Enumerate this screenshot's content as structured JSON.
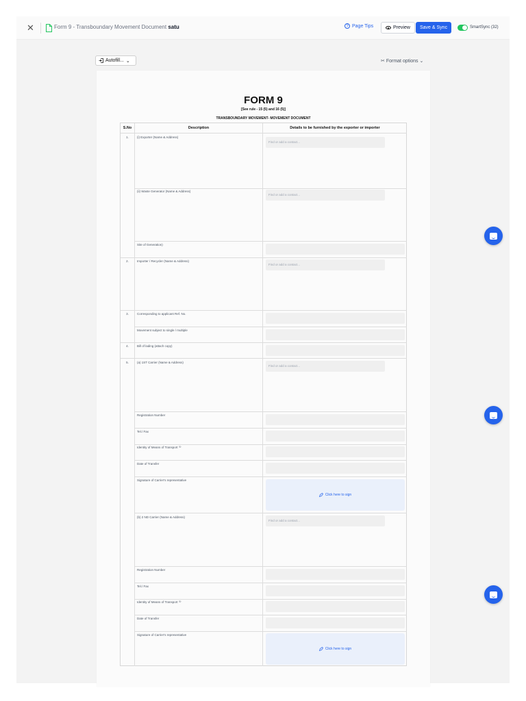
{
  "header": {
    "close_icon": "close-icon",
    "doc_icon": "document-icon",
    "title": "Form 9 - Transboundary Movement Document",
    "title_suffix": "satu",
    "page_tips": "Page Tips",
    "preview": "Preview",
    "save_sync": "Save & Sync",
    "smartsync": "SmartSync (32)",
    "smartsync_on": true,
    "accent": "#2563eb",
    "toggle_color": "#22c55e"
  },
  "toolbar": {
    "autofill": "Autofill...",
    "format_options": "Format options"
  },
  "form": {
    "title": "FORM 9",
    "rule": "[See rule - 15 (5) and 16 (5)]",
    "subtitle": "TRANSBOUNDARY MOVEMENT- MOVEMENT DOCUMENT",
    "col_sno": "S.No",
    "col_desc": "Description",
    "col_details": "Details to be furnished by the exporter or importer",
    "contact_placeholder": "Find or add a contact...",
    "sign_label": "Click here to sign",
    "rows": {
      "r1_sno": "1.",
      "r1_exporter": "(i) Exporter (Name & Address)",
      "r1_generator": "(ii) Waste Generator (Name & Address)",
      "r1_site": "Site of Generation)",
      "r2_sno": "2.",
      "r2_importer": "Importer / Recycler (Name & Address)",
      "r3_sno": "3.",
      "r3_ref": "Corresponding to applicant Ref. No.",
      "r3_movement": "Movement subject to single / multiple",
      "r4_sno": "4.",
      "r4_bill": "Bill of lading (attach copy)",
      "r5_sno": "5.",
      "r5_first_carrier": "(a) 1ST Carrier (Name & Address)",
      "r5_reg1": "Registration Number",
      "r5_tel1": "Tel./ Fax",
      "r5_identity1": "Identity of Means of Transport ⁽³⁾",
      "r5_date1": "Date of Transfer",
      "r5_sig1": "Signature of Carrier's representative",
      "r5_second_carrier": "(b) 2 ND Carrier (Name & Address)",
      "r5_reg2": "Registration Number",
      "r5_tel2": "Tel./ Fax",
      "r5_identity2": "Identity of Means of Transport ⁽³⁾",
      "r5_date2": "Date of Transfer",
      "r5_sig2": "Signature of Carrier's representative"
    }
  },
  "chat_icon": "chat-icon"
}
